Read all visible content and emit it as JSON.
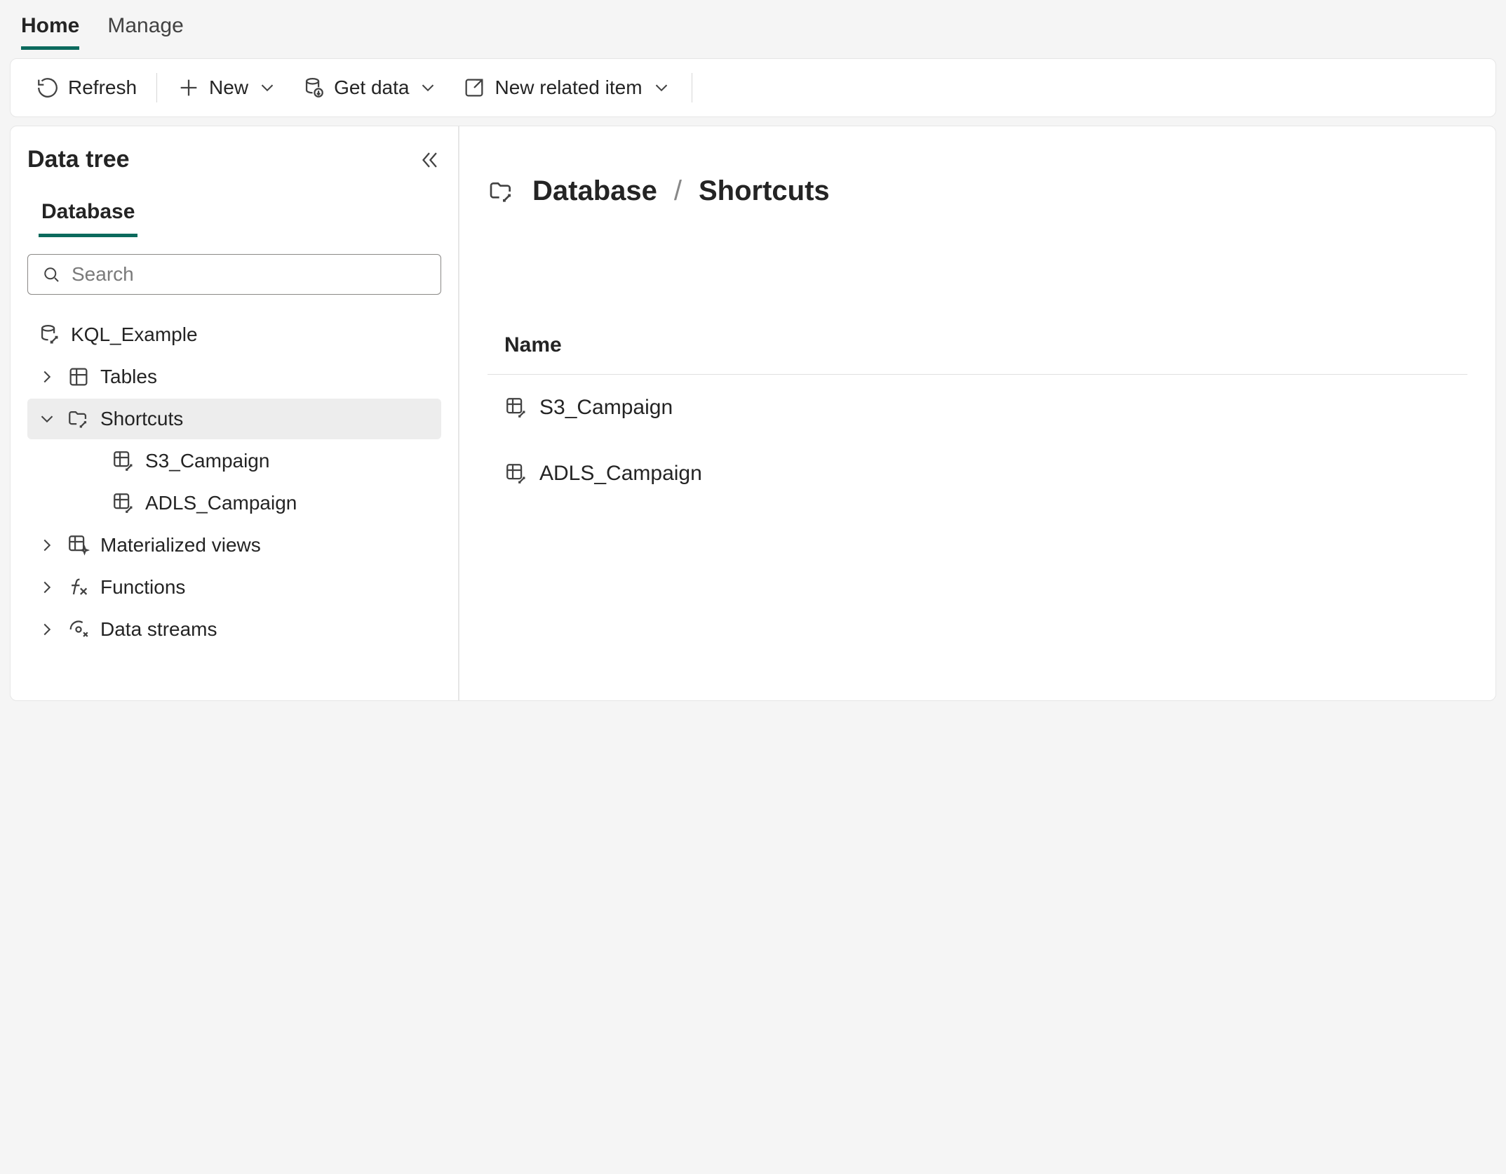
{
  "tabs": {
    "home": "Home",
    "manage": "Manage"
  },
  "toolbar": {
    "refresh": "Refresh",
    "new": "New",
    "get_data": "Get data",
    "new_related": "New related item"
  },
  "sidebar": {
    "title": "Data tree",
    "sub_tab": "Database",
    "search_placeholder": "Search",
    "root": "KQL_Example",
    "nodes": {
      "tables": "Tables",
      "shortcuts": "Shortcuts",
      "mat_views": "Materialized views",
      "functions": "Functions",
      "data_streams": "Data streams"
    },
    "shortcuts_children": [
      "S3_Campaign",
      "ADLS_Campaign"
    ]
  },
  "breadcrumb": {
    "root": "Database",
    "current": "Shortcuts"
  },
  "table": {
    "column_name": "Name",
    "rows": [
      "S3_Campaign",
      "ADLS_Campaign"
    ]
  }
}
